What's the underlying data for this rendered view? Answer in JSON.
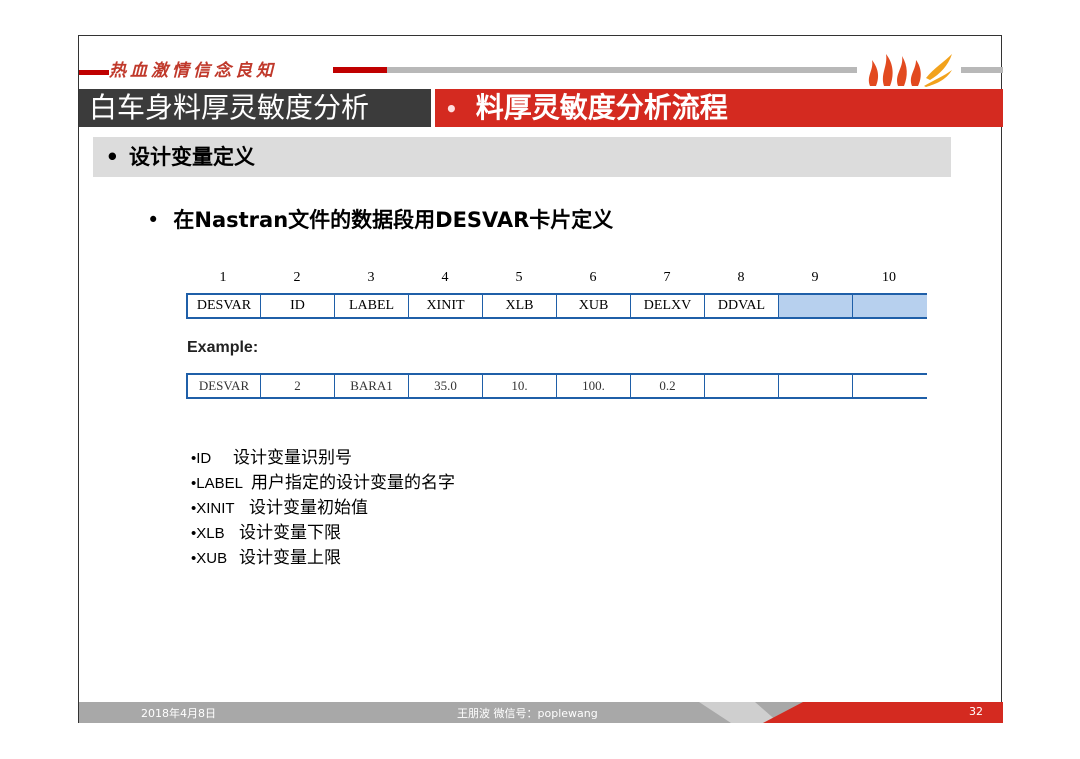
{
  "slogan": "热血激情信念良知",
  "title_left": "白车身料厚灵敏度分析",
  "title_right": "料厚灵敏度分析流程",
  "section": "设计变量定义",
  "subhead": "在Nastran文件的数据段用DESVAR卡片定义",
  "table": {
    "column_numbers": [
      "1",
      "2",
      "3",
      "4",
      "5",
      "6",
      "7",
      "8",
      "9",
      "10"
    ],
    "header_row": [
      "DESVAR",
      "ID",
      "LABEL",
      "XINIT",
      "XLB",
      "XUB",
      "DELXV",
      "DDVAL",
      "",
      ""
    ],
    "example_label": "Example:",
    "example_row": [
      "DESVAR",
      "2",
      "BARA1",
      "35.0",
      "10.",
      "100.",
      "0.2",
      "",
      "",
      ""
    ]
  },
  "definitions": [
    {
      "term": "•ID",
      "desc": "设计变量识别号"
    },
    {
      "term": "•LABEL",
      "desc": "用户指定的设计变量的名字"
    },
    {
      "term": "•XINIT",
      "desc": "设计变量初始值"
    },
    {
      "term": "•XLB",
      "desc": "设计变量下限"
    },
    {
      "term": "•XUB",
      "desc": "设计变量上限"
    }
  ],
  "footer": {
    "date": "2018年4月8日",
    "author": "王朋波  微信号：poplewang",
    "page": "32"
  },
  "colors": {
    "accent_red": "#d42a20",
    "dark_title": "#3b3b3b",
    "table_blue": "#1f5fa8",
    "cell_fill": "#b7d0ee"
  }
}
